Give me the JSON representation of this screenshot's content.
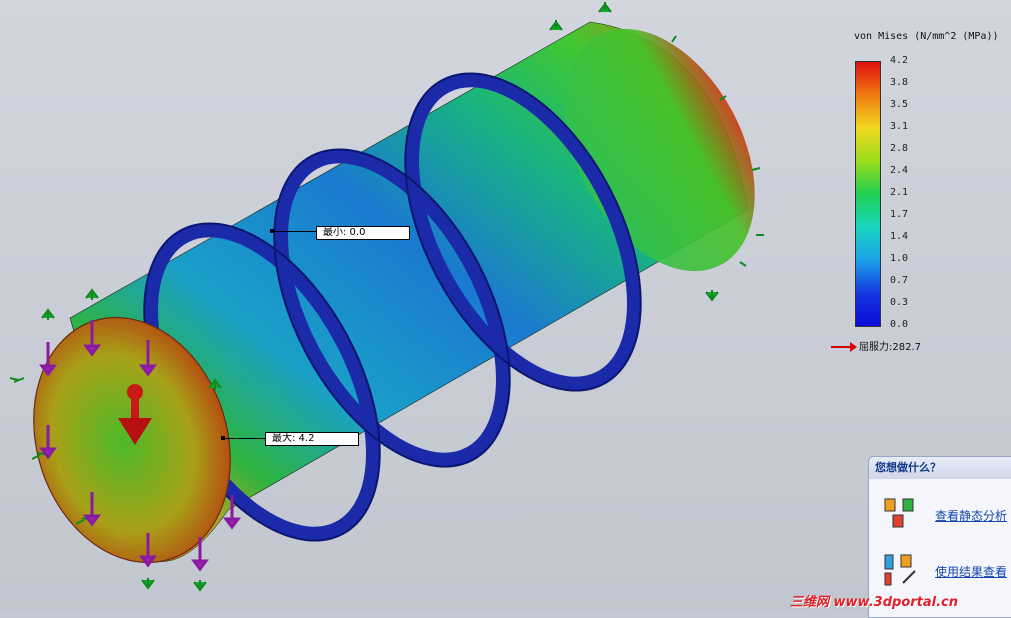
{
  "legend": {
    "title": "von Mises (N/mm^2 (MPa))",
    "ticks": [
      "4.2",
      "3.8",
      "3.5",
      "3.1",
      "2.8",
      "2.4",
      "2.1",
      "1.7",
      "1.4",
      "1.0",
      "0.7",
      "0.3",
      "0.0"
    ],
    "yield_label": "屈服力:282.7",
    "colors": [
      "#e01010",
      "#f07a10",
      "#f0d820",
      "#9adc1c",
      "#20d050",
      "#18d6c0",
      "#1aa2e8",
      "#1638e0",
      "#0a0ad8"
    ]
  },
  "probes": {
    "min_label": "最小:  0.0",
    "max_label": "最大:  4.2"
  },
  "task_panel": {
    "title": "您想做什么？",
    "link_static": "查看静态分析",
    "link_results": "使用结果查看"
  },
  "watermark": "三维网 www.3dportal.cn"
}
